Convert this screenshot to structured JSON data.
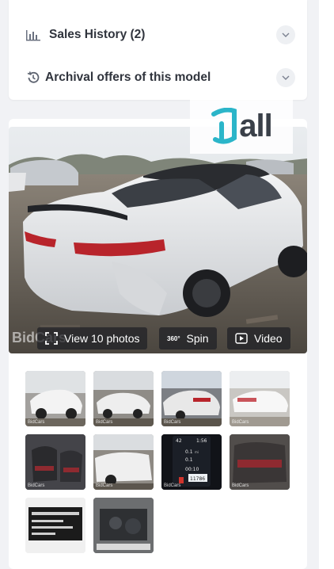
{
  "accordion": {
    "sales_history_label": "Sales History (2)",
    "archival_label": "Archival offers of this model"
  },
  "logo": {
    "text": "all"
  },
  "photo": {
    "watermark": "BidCars",
    "buttons": {
      "view_photos": "View 10 photos",
      "spin_badge": "360°",
      "spin": "Spin",
      "video": "Video"
    }
  },
  "thumbnails": [
    {
      "caption": "BidCars"
    },
    {
      "caption": "BidCars"
    },
    {
      "caption": "BidCars"
    },
    {
      "caption": "BidCars"
    },
    {
      "caption": "BidCars"
    },
    {
      "caption": "BidCars"
    },
    {
      "caption": "BidCars",
      "dash": {
        "speed": "42",
        "time": "1:56",
        "range": "0.1",
        "range_unit": "mi",
        "gal": "0.1",
        "clock": "00:10",
        "odo": "11786"
      }
    },
    {
      "caption": "BidCars"
    },
    {
      "caption": ""
    },
    {
      "caption": ""
    }
  ],
  "colors": {
    "accent": "#2bb5c9",
    "text": "#30343d",
    "card": "#ffffff",
    "bg": "#f1f2f5"
  }
}
